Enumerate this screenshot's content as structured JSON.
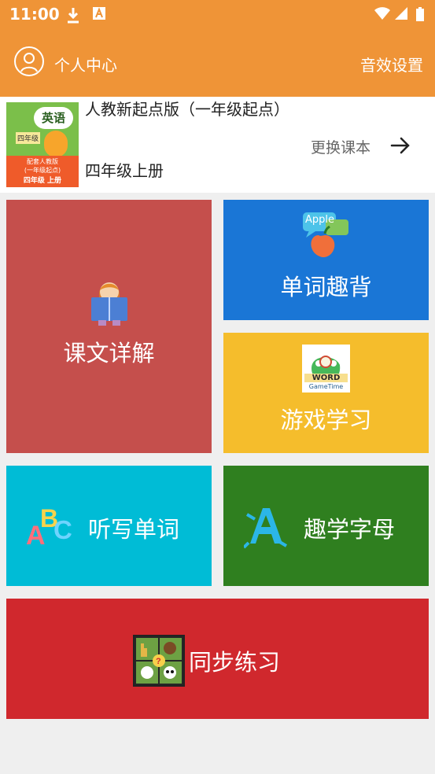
{
  "status": {
    "time": "11:00"
  },
  "header": {
    "personal_center": "个人中心",
    "sound_settings": "音效设置"
  },
  "book": {
    "name": "人教新起点版（一年级起点）",
    "grade": "四年级上册",
    "change_label": "更换课本",
    "cover_title": "英语",
    "cover_grade": "四年级",
    "cover_publisher": "配套人教版",
    "cover_subtitle": "(一年级起点)",
    "cover_bottom": "四年级 上册"
  },
  "menu": {
    "lesson": "课文详解",
    "words": "单词趣背",
    "games": "游戏学习",
    "dictation": "听写单词",
    "letters": "趣学字母",
    "practice": "同步练习",
    "word_logo_apple": "Apple",
    "word_logo_word": "WORD",
    "word_logo_game": "GameTime"
  },
  "colors": {
    "header": "#ef9437",
    "lesson": "#c54f4c",
    "words": "#1a76d6",
    "games": "#f5bd2c",
    "dictation": "#00bcd6",
    "letters": "#2f7f1f",
    "practice": "#d0282d"
  }
}
